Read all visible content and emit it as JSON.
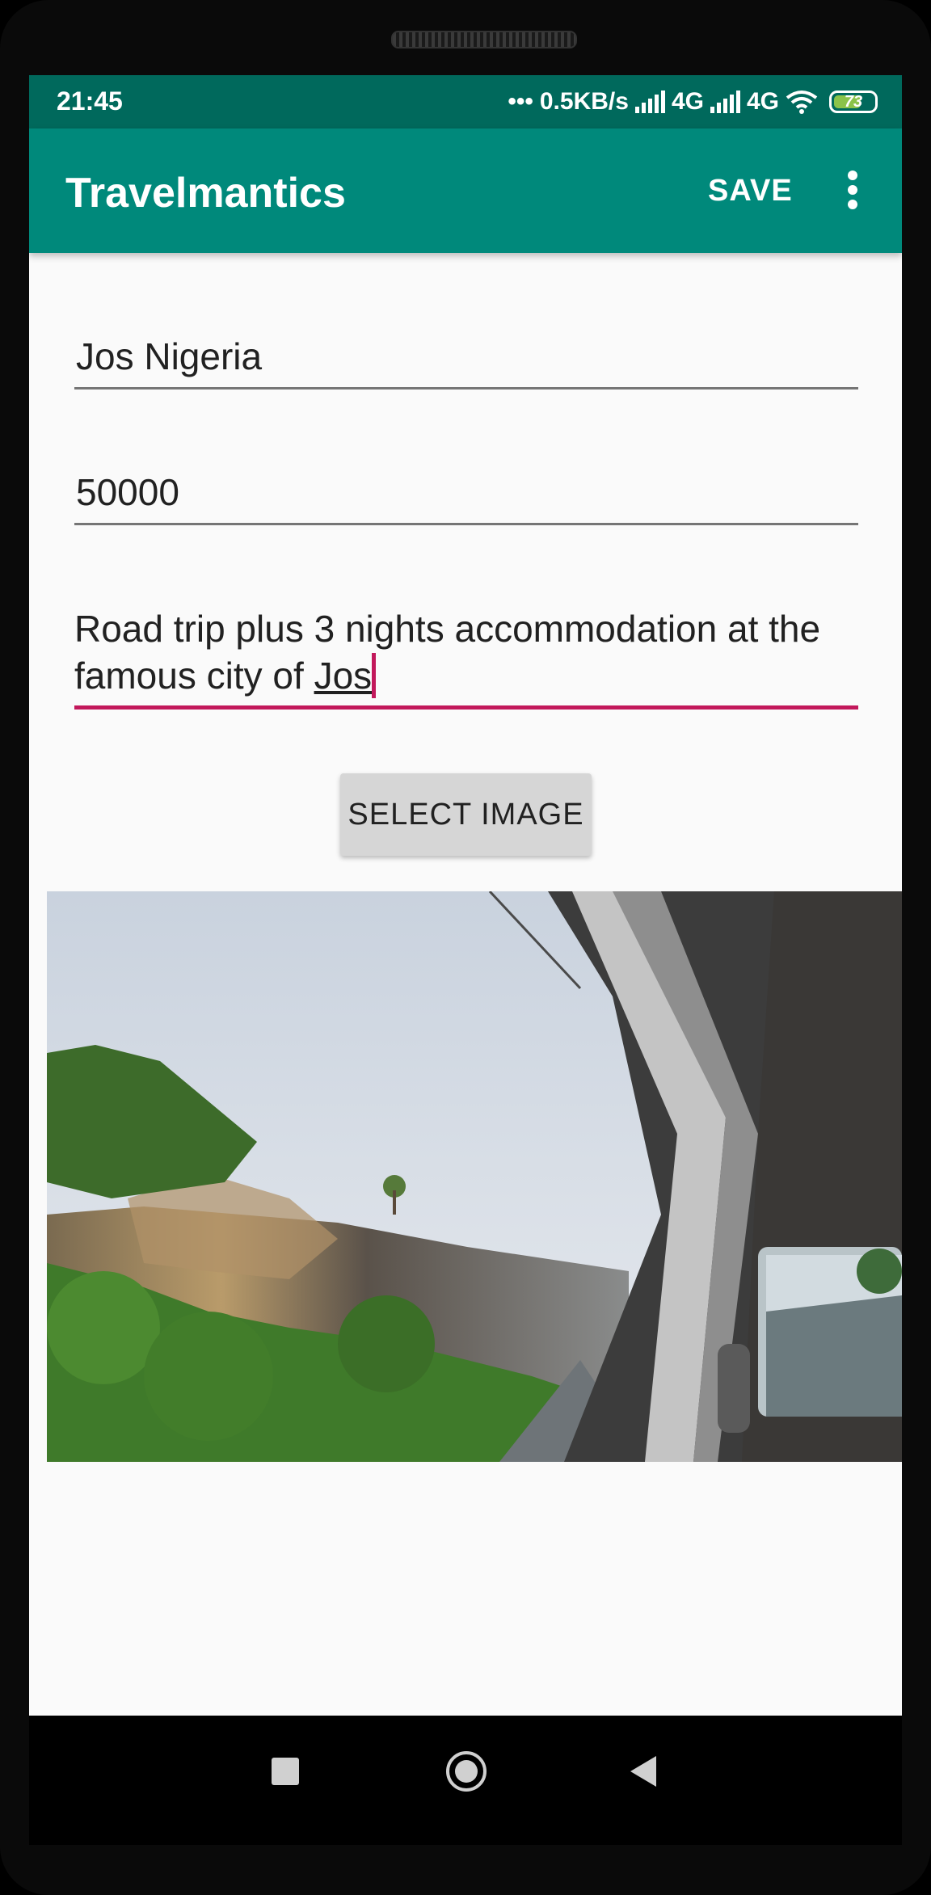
{
  "status_bar": {
    "time": "21:45",
    "network_speed": "0.5KB/s",
    "network_type_1": "4G",
    "network_type_2": "4G",
    "battery_level": "73"
  },
  "app_bar": {
    "title": "Travelmantics",
    "save_label": "SAVE",
    "overflow_icon": "more-vert-icon"
  },
  "form": {
    "title_value": "Jos Nigeria",
    "price_value": "50000",
    "description_main": "Road trip plus 3 nights accommodation at the famous city of ",
    "description_last_word": "Jos",
    "select_image_label": "SELECT IMAGE"
  },
  "colors": {
    "primary": "#00897b",
    "primary_dark": "#00695c",
    "accent": "#c2185b"
  },
  "nav_bar": {
    "recents_icon": "square-icon",
    "home_icon": "circle-icon",
    "back_icon": "triangle-back-icon"
  }
}
